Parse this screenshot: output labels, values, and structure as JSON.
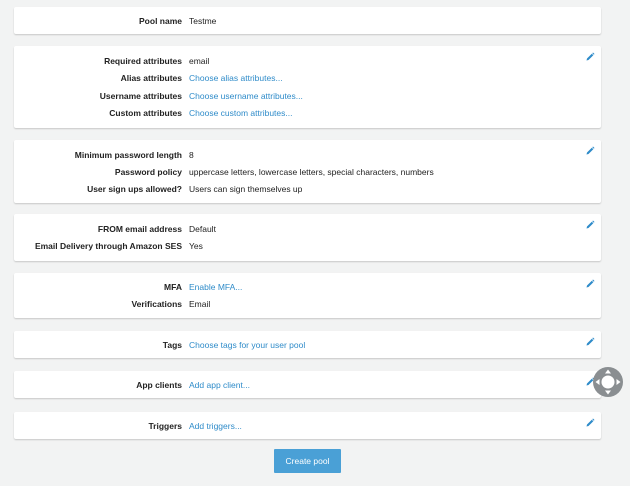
{
  "sections": {
    "pool": {
      "pool_name_label": "Pool name",
      "pool_name_value": "Testme"
    },
    "attributes": {
      "required_label": "Required attributes",
      "required_value": "email",
      "alias_label": "Alias attributes",
      "alias_link": "Choose alias attributes...",
      "username_label": "Username attributes",
      "username_link": "Choose username attributes...",
      "custom_label": "Custom attributes",
      "custom_link": "Choose custom attributes..."
    },
    "policies": {
      "min_length_label": "Minimum password length",
      "min_length_value": "8",
      "policy_label": "Password policy",
      "policy_value": "uppercase letters, lowercase letters, special characters, numbers",
      "signup_label": "User sign ups allowed?",
      "signup_value": "Users can sign themselves up"
    },
    "email": {
      "from_label": "FROM email address",
      "from_value": "Default",
      "ses_label": "Email Delivery through Amazon SES",
      "ses_value": "Yes"
    },
    "mfa": {
      "mfa_label": "MFA",
      "mfa_link": "Enable MFA...",
      "verif_label": "Verifications",
      "verif_value": "Email"
    },
    "tags": {
      "tags_label": "Tags",
      "tags_link": "Choose tags for your user pool"
    },
    "app_clients": {
      "label": "App clients",
      "link": "Add app client..."
    },
    "triggers": {
      "label": "Triggers",
      "link": "Add triggers..."
    }
  },
  "create_button": "Create pool",
  "icons": {
    "edit": "pencil-icon",
    "scroll": "scroll-control-icon"
  },
  "colors": {
    "link": "#2e8bc9",
    "button": "#4aa0d6",
    "background": "#f2f3f3"
  }
}
